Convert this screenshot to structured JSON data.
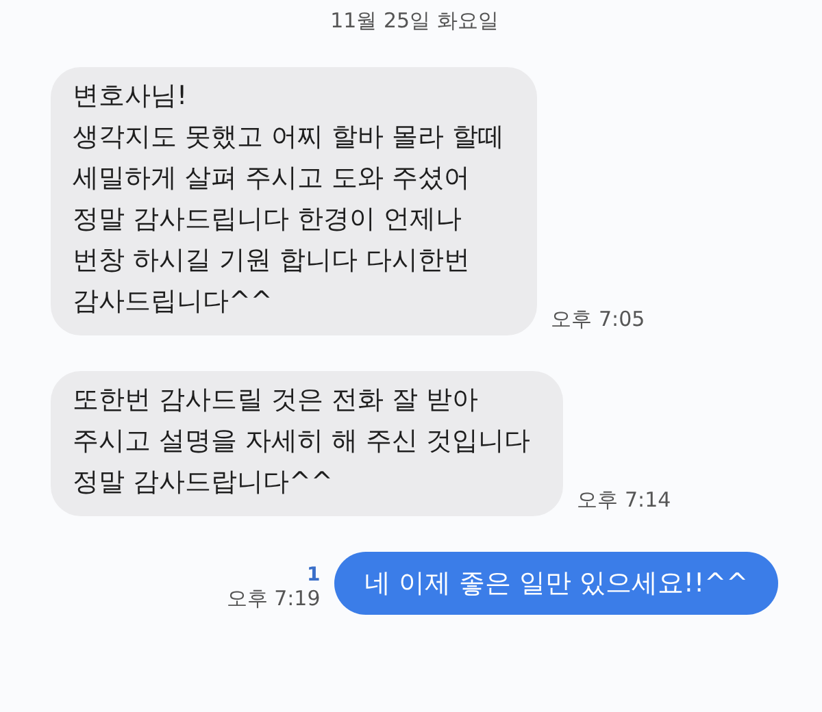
{
  "date_divider": "11월 25일 화요일",
  "messages": [
    {
      "kind": "incoming",
      "text": "변호사님!\n생각지도 못했고 어찌 할바 몰라 할떼\n세밀하게 살펴 주시고 도와 주셨어\n정말 감사드립니다 한경이 언제나\n번창 하시길 기원 합니다 다시한번\n감사드립니다^^",
      "time": "오후 7:05"
    },
    {
      "kind": "incoming",
      "text": "또한번 감사드릴 것은 전화 잘 받아\n주시고 설명을 자세히 해 주신 것입니다\n정말 감사드랍니다^^",
      "time": "오후 7:14"
    },
    {
      "kind": "outgoing",
      "text": "네 이제 좋은 일만 있으세요!!^^",
      "time": "오후 7:19",
      "unread_count": "1"
    }
  ]
}
